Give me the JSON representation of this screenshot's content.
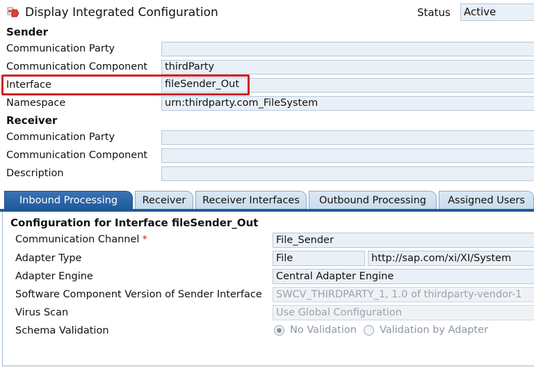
{
  "header": {
    "title": "Display Integrated Configuration",
    "status_label": "Status",
    "status_value": "Active",
    "icon": "integrated-configuration-icon"
  },
  "sender": {
    "heading": "Sender",
    "party_label": "Communication Party",
    "party_value": "",
    "component_label": "Communication Component",
    "component_value": "thirdParty",
    "interface_label": "Interface",
    "interface_value": "fileSender_Out",
    "namespace_label": "Namespace",
    "namespace_value": "urn:thirdparty.com_FileSystem"
  },
  "receiver": {
    "heading": "Receiver",
    "party_label": "Communication Party",
    "party_value": "",
    "component_label": "Communication Component",
    "component_value": "",
    "description_label": "Description",
    "description_value": ""
  },
  "tabs": [
    {
      "label": "Inbound Processing",
      "active": true
    },
    {
      "label": "Receiver",
      "active": false
    },
    {
      "label": "Receiver Interfaces",
      "active": false
    },
    {
      "label": "Outbound Processing",
      "active": false
    },
    {
      "label": "Assigned Users",
      "active": false
    }
  ],
  "inbound": {
    "title": "Configuration for Interface fileSender_Out",
    "channel_label": "Communication Channel",
    "required_mark": "*",
    "channel_value": "File_Sender",
    "adapter_type_label": "Adapter Type",
    "adapter_type_value": "File",
    "adapter_ns_value": "http://sap.com/xi/XI/System",
    "adapter_engine_label": "Adapter Engine",
    "adapter_engine_value": "Central Adapter Engine",
    "swcv_label": "Software Component Version of Sender Interface",
    "swcv_value": "SWCV_THIRDPARTY_1, 1.0 of thirdparty-vendor-1",
    "virus_label": "Virus Scan",
    "virus_value": "Use Global Configuration",
    "schema_label": "Schema Validation",
    "schema_options": [
      "No Validation",
      "Validation by Adapter"
    ],
    "schema_selected": "No Validation"
  },
  "colors": {
    "active_tab": "#1e5a99",
    "highlight": "#d0201d",
    "field_bg": "#e9f0f7"
  }
}
